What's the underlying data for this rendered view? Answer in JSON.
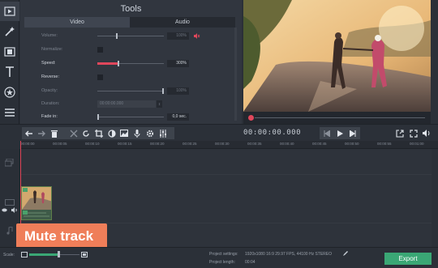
{
  "window": {
    "title": "Tools"
  },
  "rail": {
    "icons": [
      "import-icon",
      "magic-wand-icon",
      "filmstrip-icon",
      "text-icon",
      "star-icon",
      "list-icon"
    ]
  },
  "tools": {
    "tabs": [
      {
        "label": "Video",
        "active": true
      },
      {
        "label": "Audio",
        "active": false
      }
    ],
    "props": {
      "volume": {
        "label": "Volume:",
        "value": "100%",
        "level": 0.3
      },
      "normalize": {
        "label": "Normalize:"
      },
      "speed": {
        "label": "Speed:",
        "value": "300%",
        "level": 0.3
      },
      "reverse": {
        "label": "Reverse:"
      },
      "opacity": {
        "label": "Opacity:",
        "value": "100%",
        "level": 1.0
      },
      "duration": {
        "label": "Duration:",
        "value": "00:00:00.000"
      },
      "fadein": {
        "label": "Fade in:",
        "value": "0,0 sec."
      }
    }
  },
  "player": {
    "timecode": "00:00:00.000"
  },
  "timeline": {
    "ticks": [
      "00:00:00",
      "00:00:05",
      "00:00:10",
      "00:00:15",
      "00:00:20",
      "00:00:25",
      "00:00:30",
      "00:00:35",
      "00:00:40",
      "00:00:45",
      "00:00:50",
      "00:00:55",
      "00:01:00"
    ]
  },
  "tooltip": {
    "text": "Mute track"
  },
  "status": {
    "scale_label": "Scale:",
    "settings_label": "Project settings:",
    "settings_value": "1920x1080 16:9 29.97 FPS, 44100 Hz STEREO",
    "length_label": "Project length:",
    "length_value": "00:04",
    "export_label": "Export"
  },
  "colors": {
    "accent": "#e0475b",
    "export": "#3aa775",
    "tooltip": "#ef7e59"
  }
}
